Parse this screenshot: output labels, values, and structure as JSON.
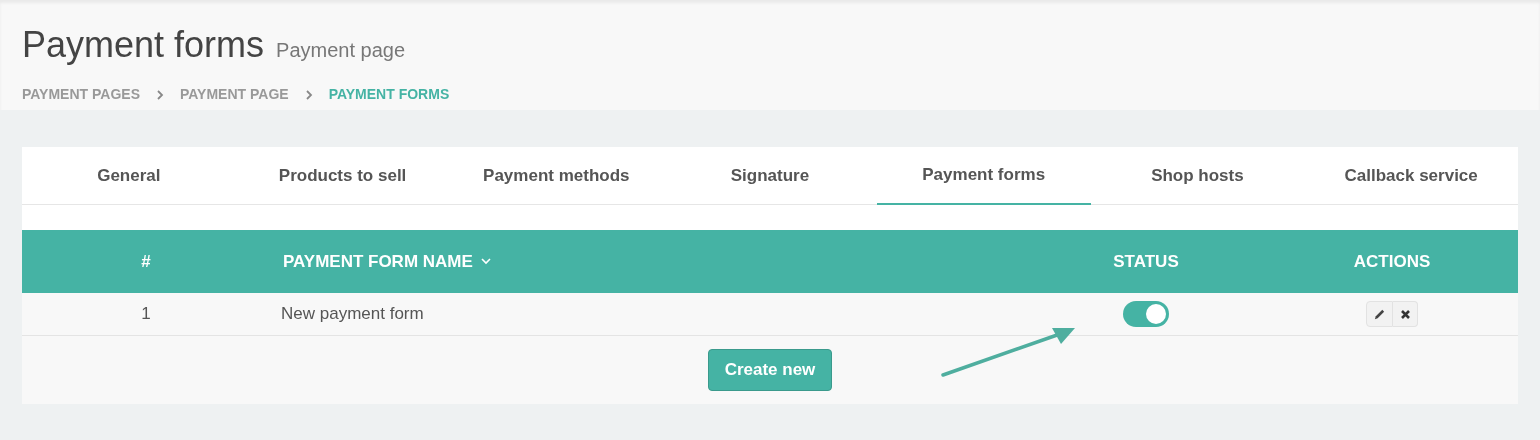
{
  "header": {
    "title": "Payment forms",
    "subtitle": "Payment page"
  },
  "breadcrumb": [
    {
      "label": "PAYMENT PAGES",
      "selected": false
    },
    {
      "label": "PAYMENT PAGE",
      "selected": false
    },
    {
      "label": "PAYMENT FORMS",
      "selected": true
    }
  ],
  "tabs": [
    {
      "label": "General",
      "selected": false
    },
    {
      "label": "Products to sell",
      "selected": false
    },
    {
      "label": "Payment methods",
      "selected": false
    },
    {
      "label": "Signature",
      "selected": false
    },
    {
      "label": "Payment forms",
      "selected": true
    },
    {
      "label": "Shop hosts",
      "selected": false
    },
    {
      "label": "Callback service",
      "selected": false
    }
  ],
  "table": {
    "columns": [
      "#",
      "PAYMENT FORM NAME",
      "STATUS",
      "ACTIONS"
    ],
    "rows": [
      {
        "number": "1",
        "name": "New payment form",
        "on": true
      }
    ]
  },
  "create_button": "Create new"
}
